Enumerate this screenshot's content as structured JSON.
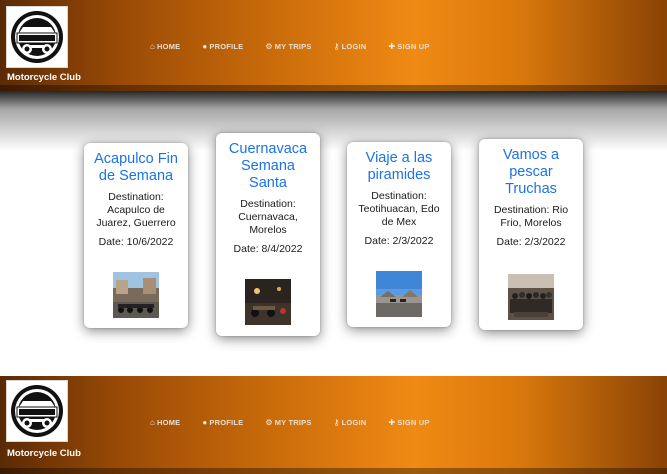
{
  "brand": "Motorcycle Club",
  "nav": [
    {
      "icon": "home-icon",
      "glyph": "⌂",
      "label": "HOME"
    },
    {
      "icon": "user-icon",
      "glyph": "●",
      "label": "PROFILE"
    },
    {
      "icon": "motorcycle-icon",
      "glyph": "⚙",
      "label": "MY TRIPS"
    },
    {
      "icon": "key-icon",
      "glyph": "⚷",
      "label": "LOGIN"
    },
    {
      "icon": "user-plus-icon",
      "glyph": "✚",
      "label": "SIGN UP"
    }
  ],
  "trips": [
    {
      "title": "Acapulco Fin de Semana",
      "destination": "Destination: Acapulco de Juarez, Guerrero",
      "date": "Date: 10/6/2022"
    },
    {
      "title": "Cuernavaca Semana Santa",
      "destination": "Destination: Cuernavaca, Morelos",
      "date": "Date: 8/4/2022"
    },
    {
      "title": "Viaje a las piramides",
      "destination": "Destination: Teotihuacan, Edo de Mex",
      "date": "Date: 2/3/2022"
    },
    {
      "title": "Vamos a pescar Truchas",
      "destination": "Destination: Rio Frio, Morelos",
      "date": "Date: 2/3/2022"
    }
  ]
}
